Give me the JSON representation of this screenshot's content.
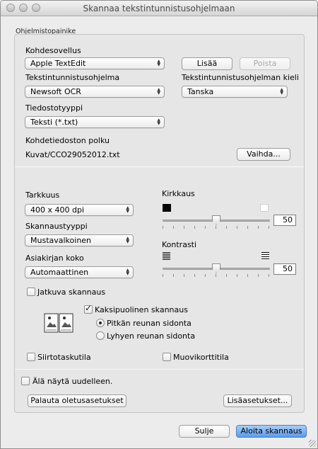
{
  "window": {
    "title": "Skannaa tekstintunnistusohjelmaan"
  },
  "group": {
    "label": "Ohjelmistopainike"
  },
  "target_app": {
    "label": "Kohdesovellus",
    "value": "Apple TextEdit"
  },
  "buttons": {
    "add": "Lisää",
    "remove": "Poista",
    "change": "Vaihda...",
    "restore_defaults": "Palauta oletusasetukset",
    "more_settings": "Lisäasetukset...",
    "close": "Sulje",
    "start_scan": "Aloita skannaus"
  },
  "ocr_app": {
    "label": "Tekstintunnistusohjelma",
    "value": "Newsoft OCR"
  },
  "ocr_language": {
    "label": "Tekstintunnistusohjelman kieli",
    "value": "Tanska"
  },
  "file_type": {
    "label": "Tiedostotyyppi",
    "value": "Teksti (*.txt)"
  },
  "destination": {
    "label": "Kohdetiedoston polku",
    "value": "Kuvat/CCO29052012.txt"
  },
  "resolution": {
    "label": "Tarkkuus",
    "value": "400 x 400 dpi"
  },
  "scan_type": {
    "label": "Skannaustyyppi",
    "value": "Mustavalkoinen"
  },
  "document_size": {
    "label": "Asiakirjan koko",
    "value": "Automaattinen"
  },
  "brightness": {
    "label": "Kirkkaus",
    "value": "50",
    "level": 50,
    "range": [
      0,
      100
    ]
  },
  "contrast": {
    "label": "Kontrasti",
    "value": "50",
    "level": 50,
    "range": [
      0,
      100
    ]
  },
  "continuous_scan": {
    "label": "Jatkuva skannaus",
    "checked": false
  },
  "duplex": {
    "label": "Kaksipuolinen skannaus",
    "checked": true
  },
  "binding": {
    "long_edge": "Pitkän reunan sidonta",
    "short_edge": "Lyhyen reunan sidonta",
    "selected": "long_edge"
  },
  "carrier_sheet": {
    "label": "Siirtotaskutila",
    "checked": false
  },
  "plastic_card": {
    "label": "Muovikorttitila",
    "checked": false
  },
  "dont_show_again": {
    "label": "Älä näytä uudelleen.",
    "checked": false
  }
}
